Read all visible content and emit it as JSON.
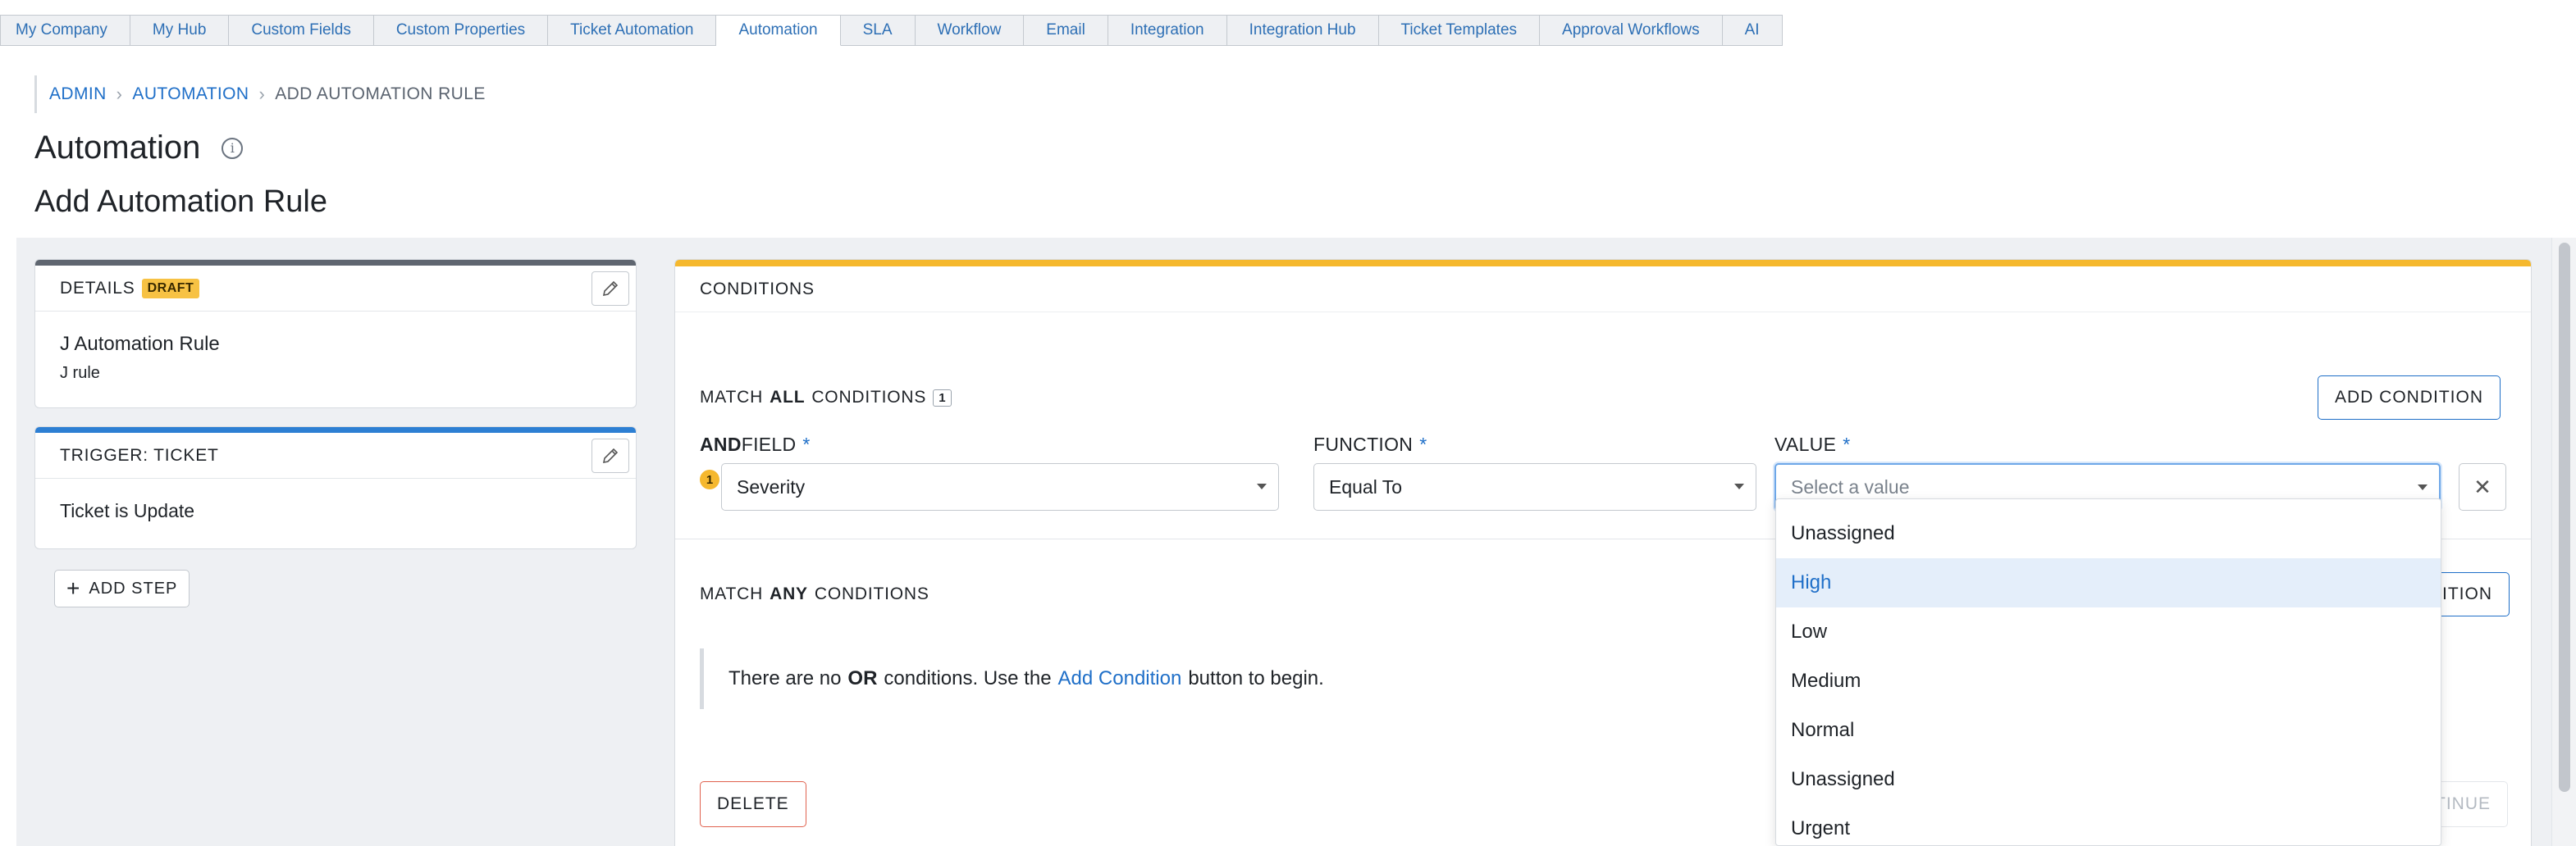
{
  "tabs": [
    {
      "label": "My Company",
      "active": false
    },
    {
      "label": "My Hub",
      "active": false
    },
    {
      "label": "Custom Fields",
      "active": false
    },
    {
      "label": "Custom Properties",
      "active": false
    },
    {
      "label": "Ticket Automation",
      "active": false
    },
    {
      "label": "Automation",
      "active": true
    },
    {
      "label": "SLA",
      "active": false
    },
    {
      "label": "Workflow",
      "active": false
    },
    {
      "label": "Email",
      "active": false
    },
    {
      "label": "Integration",
      "active": false
    },
    {
      "label": "Integration Hub",
      "active": false
    },
    {
      "label": "Ticket Templates",
      "active": false
    },
    {
      "label": "Approval Workflows",
      "active": false
    },
    {
      "label": "AI",
      "active": false
    }
  ],
  "breadcrumb": {
    "admin": "ADMIN",
    "automation": "AUTOMATION",
    "current": "ADD AUTOMATION RULE"
  },
  "page": {
    "title": "Automation",
    "subtitle": "Add Automation Rule"
  },
  "details_card": {
    "title": "DETAILS",
    "badge": "DRAFT",
    "name": "J Automation Rule",
    "description": "J rule"
  },
  "trigger_card": {
    "title": "TRIGGER: TICKET",
    "body": "Ticket is Update"
  },
  "add_step": "ADD STEP",
  "conditions": {
    "title": "CONDITIONS",
    "match_all": {
      "prefix": "MATCH",
      "emph": "ALL",
      "suffix": "CONDITIONS",
      "count": "1"
    },
    "add_condition": "ADD CONDITION",
    "add_condition_partial": "ITION",
    "row": {
      "and_label": "AND",
      "field_label": "FIELD",
      "function_label": "FUNCTION",
      "value_label": "VALUE",
      "required": "*",
      "index": "1",
      "field_value": "Severity",
      "function_value": "Equal To",
      "value_placeholder": "Select a value"
    },
    "match_any": {
      "prefix": "MATCH",
      "emph": "ANY",
      "suffix": "CONDITIONS"
    },
    "note": {
      "pre": "There are no",
      "bold": "OR",
      "mid": "conditions. Use the",
      "link": "Add Condition",
      "post": "button to begin."
    },
    "delete": "DELETE",
    "continue_partial": "TINUE"
  },
  "dropdown_options": [
    "Unassigned",
    "High",
    "Low",
    "Medium",
    "Normal",
    "Unassigned",
    "Urgent"
  ],
  "dropdown_highlighted_index": 1,
  "colors": {
    "accent": "#1f6fc8",
    "draft_badge": "#f7c244",
    "conditions_bar": "#f5b82e",
    "details_bar": "#5f6670",
    "trigger_bar": "#2d7fd3",
    "delete_border": "#e0624f"
  }
}
